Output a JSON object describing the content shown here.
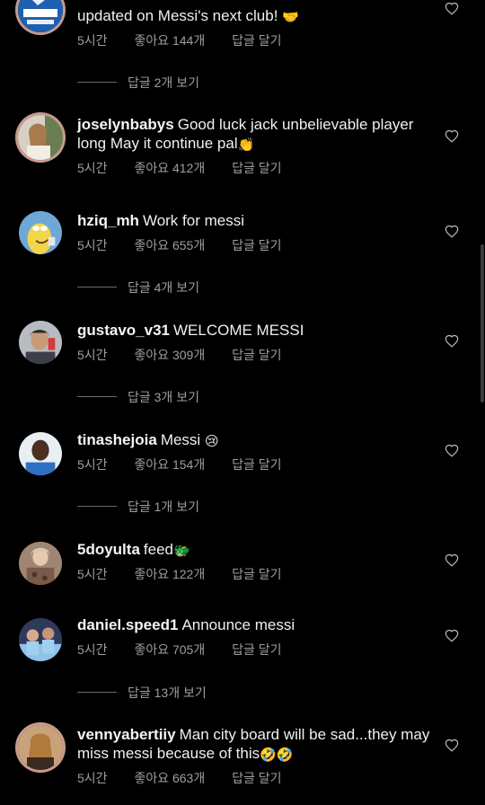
{
  "comments": [
    {
      "username": "",
      "text": "updated on Messi's next club!",
      "emoji": "🤝",
      "time": "5시간",
      "likes": "좋아요 144개",
      "reply": "답글 달기",
      "view_replies": "답글 2개 보기"
    },
    {
      "username": "joselynbabys",
      "text": "Good luck jack unbelievable player long May it continue pal",
      "emoji": "👏",
      "time": "5시간",
      "likes": "좋아요 412개",
      "reply": "답글 달기"
    },
    {
      "username": "hziq_mh",
      "text": "Work for messi",
      "time": "5시간",
      "likes": "좋아요 655개",
      "reply": "답글 달기",
      "view_replies": "답글 4개 보기"
    },
    {
      "username": "gustavo_v31",
      "text": "WELCOME MESSI",
      "time": "5시간",
      "likes": "좋아요 309개",
      "reply": "답글 달기",
      "view_replies": "답글 3개 보기"
    },
    {
      "username": "tinashejoia",
      "text": "Messi",
      "emoji": "😢",
      "time": "5시간",
      "likes": "좋아요 154개",
      "reply": "답글 달기",
      "view_replies": "답글 1개 보기"
    },
    {
      "username": "5doyulta",
      "text": "feed",
      "emoji": "🐲",
      "time": "5시간",
      "likes": "좋아요 122개",
      "reply": "답글 달기"
    },
    {
      "username": "daniel.speed1",
      "text": "Announce messi",
      "time": "5시간",
      "likes": "좋아요 705개",
      "reply": "답글 달기",
      "view_replies": "답글 13개 보기"
    },
    {
      "username": "vennyabertiiy",
      "text": "Man city board will be sad...they may miss messi because of this",
      "emoji": "🤣🤣",
      "time": "5시간",
      "likes": "좋아요 663개",
      "reply": "답글 달기"
    }
  ],
  "colors": {
    "background": "#000000",
    "text": "#f0f0f0",
    "meta": "#9e9e9e",
    "story_ring": "#c79a8e"
  }
}
